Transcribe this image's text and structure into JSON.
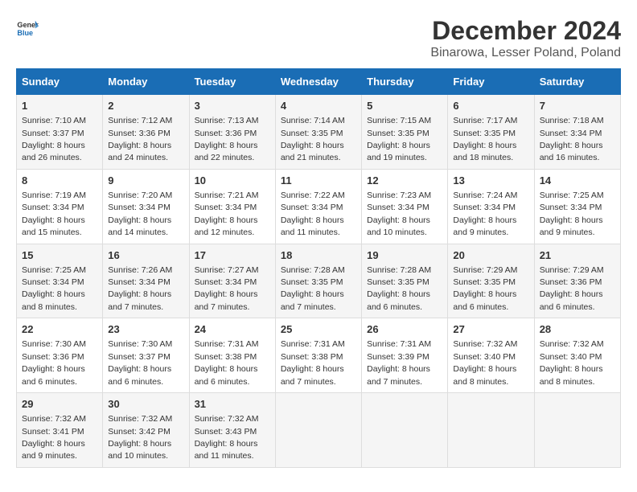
{
  "logo": {
    "line1": "General",
    "line2": "Blue"
  },
  "title": "December 2024",
  "subtitle": "Binarowa, Lesser Poland, Poland",
  "days_of_week": [
    "Sunday",
    "Monday",
    "Tuesday",
    "Wednesday",
    "Thursday",
    "Friday",
    "Saturday"
  ],
  "weeks": [
    [
      {
        "day": "1",
        "sunrise": "7:10 AM",
        "sunset": "3:37 PM",
        "daylight": "8 hours and 26 minutes."
      },
      {
        "day": "2",
        "sunrise": "7:12 AM",
        "sunset": "3:36 PM",
        "daylight": "8 hours and 24 minutes."
      },
      {
        "day": "3",
        "sunrise": "7:13 AM",
        "sunset": "3:36 PM",
        "daylight": "8 hours and 22 minutes."
      },
      {
        "day": "4",
        "sunrise": "7:14 AM",
        "sunset": "3:35 PM",
        "daylight": "8 hours and 21 minutes."
      },
      {
        "day": "5",
        "sunrise": "7:15 AM",
        "sunset": "3:35 PM",
        "daylight": "8 hours and 19 minutes."
      },
      {
        "day": "6",
        "sunrise": "7:17 AM",
        "sunset": "3:35 PM",
        "daylight": "8 hours and 18 minutes."
      },
      {
        "day": "7",
        "sunrise": "7:18 AM",
        "sunset": "3:34 PM",
        "daylight": "8 hours and 16 minutes."
      }
    ],
    [
      {
        "day": "8",
        "sunrise": "7:19 AM",
        "sunset": "3:34 PM",
        "daylight": "8 hours and 15 minutes."
      },
      {
        "day": "9",
        "sunrise": "7:20 AM",
        "sunset": "3:34 PM",
        "daylight": "8 hours and 14 minutes."
      },
      {
        "day": "10",
        "sunrise": "7:21 AM",
        "sunset": "3:34 PM",
        "daylight": "8 hours and 12 minutes."
      },
      {
        "day": "11",
        "sunrise": "7:22 AM",
        "sunset": "3:34 PM",
        "daylight": "8 hours and 11 minutes."
      },
      {
        "day": "12",
        "sunrise": "7:23 AM",
        "sunset": "3:34 PM",
        "daylight": "8 hours and 10 minutes."
      },
      {
        "day": "13",
        "sunrise": "7:24 AM",
        "sunset": "3:34 PM",
        "daylight": "8 hours and 9 minutes."
      },
      {
        "day": "14",
        "sunrise": "7:25 AM",
        "sunset": "3:34 PM",
        "daylight": "8 hours and 9 minutes."
      }
    ],
    [
      {
        "day": "15",
        "sunrise": "7:25 AM",
        "sunset": "3:34 PM",
        "daylight": "8 hours and 8 minutes."
      },
      {
        "day": "16",
        "sunrise": "7:26 AM",
        "sunset": "3:34 PM",
        "daylight": "8 hours and 7 minutes."
      },
      {
        "day": "17",
        "sunrise": "7:27 AM",
        "sunset": "3:34 PM",
        "daylight": "8 hours and 7 minutes."
      },
      {
        "day": "18",
        "sunrise": "7:28 AM",
        "sunset": "3:35 PM",
        "daylight": "8 hours and 7 minutes."
      },
      {
        "day": "19",
        "sunrise": "7:28 AM",
        "sunset": "3:35 PM",
        "daylight": "8 hours and 6 minutes."
      },
      {
        "day": "20",
        "sunrise": "7:29 AM",
        "sunset": "3:35 PM",
        "daylight": "8 hours and 6 minutes."
      },
      {
        "day": "21",
        "sunrise": "7:29 AM",
        "sunset": "3:36 PM",
        "daylight": "8 hours and 6 minutes."
      }
    ],
    [
      {
        "day": "22",
        "sunrise": "7:30 AM",
        "sunset": "3:36 PM",
        "daylight": "8 hours and 6 minutes."
      },
      {
        "day": "23",
        "sunrise": "7:30 AM",
        "sunset": "3:37 PM",
        "daylight": "8 hours and 6 minutes."
      },
      {
        "day": "24",
        "sunrise": "7:31 AM",
        "sunset": "3:38 PM",
        "daylight": "8 hours and 6 minutes."
      },
      {
        "day": "25",
        "sunrise": "7:31 AM",
        "sunset": "3:38 PM",
        "daylight": "8 hours and 7 minutes."
      },
      {
        "day": "26",
        "sunrise": "7:31 AM",
        "sunset": "3:39 PM",
        "daylight": "8 hours and 7 minutes."
      },
      {
        "day": "27",
        "sunrise": "7:32 AM",
        "sunset": "3:40 PM",
        "daylight": "8 hours and 8 minutes."
      },
      {
        "day": "28",
        "sunrise": "7:32 AM",
        "sunset": "3:40 PM",
        "daylight": "8 hours and 8 minutes."
      }
    ],
    [
      {
        "day": "29",
        "sunrise": "7:32 AM",
        "sunset": "3:41 PM",
        "daylight": "8 hours and 9 minutes."
      },
      {
        "day": "30",
        "sunrise": "7:32 AM",
        "sunset": "3:42 PM",
        "daylight": "8 hours and 10 minutes."
      },
      {
        "day": "31",
        "sunrise": "7:32 AM",
        "sunset": "3:43 PM",
        "daylight": "8 hours and 11 minutes."
      },
      null,
      null,
      null,
      null
    ]
  ],
  "labels": {
    "sunrise": "Sunrise:",
    "sunset": "Sunset:",
    "daylight": "Daylight:"
  }
}
